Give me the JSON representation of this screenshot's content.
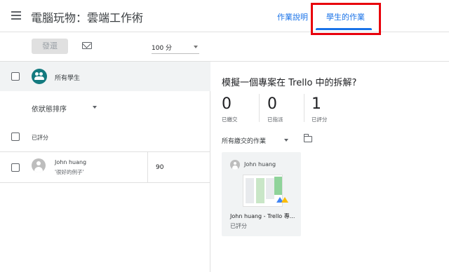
{
  "header": {
    "class_title": "電腦玩物：雲端工作術",
    "tabs": [
      {
        "label": "作業說明"
      },
      {
        "label": "學生的作業"
      }
    ]
  },
  "toolbar": {
    "return_label": "發還",
    "points_value": "100 分"
  },
  "roster": {
    "all_students_label": "所有學生",
    "sort_label": "依狀態排序",
    "graded_section_label": "已評分",
    "students": [
      {
        "name": "John huang",
        "comment": "'很好的例子'",
        "grade": "90"
      }
    ]
  },
  "assignment": {
    "title": "模擬一個專案在 Trello 中的拆解?",
    "stats": [
      {
        "value": "0",
        "label": "已繳交"
      },
      {
        "value": "0",
        "label": "已指派"
      },
      {
        "value": "1",
        "label": "已評分"
      }
    ],
    "filter_label": "所有繳交的作業",
    "submissions": [
      {
        "student": "John huang",
        "file": "John huang - Trello 專...",
        "status": "已評分"
      }
    ]
  },
  "colors": {
    "accent": "#1a73e8",
    "highlight": "#e8000b",
    "group_avatar": "#137a7f"
  }
}
